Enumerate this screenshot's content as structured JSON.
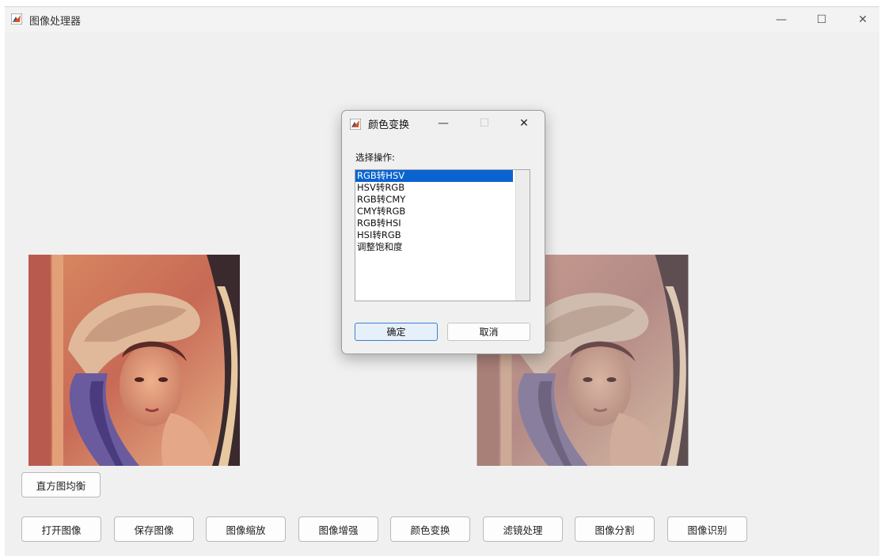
{
  "window": {
    "title": "图像处理器",
    "minimize_glyph": "—",
    "maximize_glyph": "☐",
    "close_glyph": "✕"
  },
  "images": {
    "original_name": "lena-original-image",
    "processed_name": "lena-processed-image"
  },
  "buttons": {
    "histogram": "直方图均衡",
    "open": "打开图像",
    "save": "保存图像",
    "scale": "图像缩放",
    "enhance": "图像增强",
    "color_transform": "颜色变换",
    "filter": "滤镜处理",
    "segment": "图像分割",
    "recognize": "图像识别"
  },
  "dialog": {
    "title": "颜色变换",
    "minimize_glyph": "—",
    "maximize_glyph": "☐",
    "close_glyph": "✕",
    "label": "选择操作:",
    "options": [
      "RGB转HSV",
      "HSV转RGB",
      "RGB转CMY",
      "CMY转RGB",
      "RGB转HSI",
      "HSI转RGB",
      "调整饱和度"
    ],
    "selected_index": 0,
    "ok": "确定",
    "cancel": "取消"
  },
  "colors": {
    "selection": "#0a64d0",
    "primary_button_bg": "#e6f0fb",
    "primary_button_border": "#3c7fd1"
  }
}
